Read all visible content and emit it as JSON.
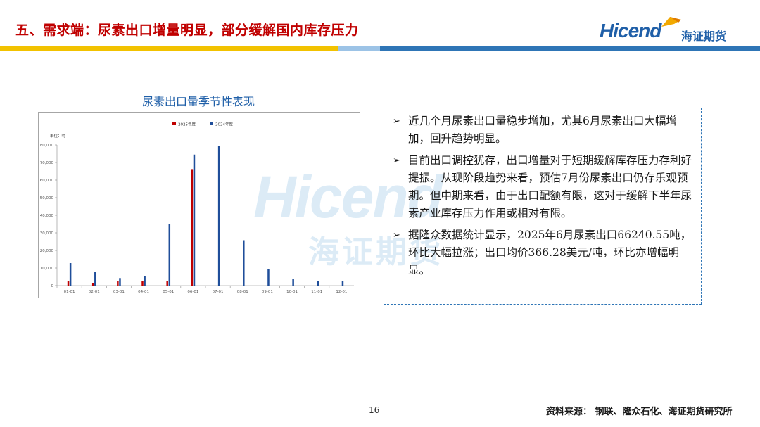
{
  "header": {
    "title": "五、需求端：尿素出口增量明显，部分缓解国内库存压力",
    "logo_en": "Hicend",
    "logo_cn": "海证期货",
    "stripe_colors": [
      "#f2c200",
      "#2e75b6"
    ]
  },
  "watermark": {
    "en": "Hicend",
    "cn": "海证期货"
  },
  "chart": {
    "heading": "尿素出口量季节性表现"
  },
  "chart_data": {
    "type": "bar",
    "title": "尿素出口量季节性表现",
    "unit_label": "单位：吨",
    "categories": [
      "01-01",
      "02-01",
      "03-01",
      "04-01",
      "05-01",
      "06-01",
      "07-01",
      "08-01",
      "09-01",
      "10-01",
      "11-01",
      "12-01"
    ],
    "series": [
      {
        "name": "2025年度",
        "color": "#c00000",
        "values": [
          2800,
          1500,
          2500,
          2500,
          2500,
          66240.55,
          null,
          null,
          null,
          null,
          null,
          null
        ]
      },
      {
        "name": "2024年度",
        "color": "#1f4e9a",
        "values": [
          12800,
          7800,
          4300,
          5300,
          35000,
          74500,
          79500,
          25800,
          9500,
          3800,
          2400,
          2400
        ]
      }
    ],
    "yticks": [
      "0",
      "10,000",
      "20,000",
      "30,000",
      "40,000",
      "50,000",
      "60,000",
      "70,000",
      "80,000"
    ],
    "ylim": [
      0,
      80000
    ],
    "legend_position": "top-center",
    "grid": false
  },
  "bullets": [
    "近几个月尿素出口量稳步增加，尤其6月尿素出口大幅增加，回升趋势明显。",
    "目前出口调控犹存，出口增量对于短期缓解库存压力存利好提振。从现阶段趋势来看，预估7月份尿素出口仍存乐观预期。但中期来看，由于出口配额有限，这对于缓解下半年尿素产业库存压力作用或相对有限。",
    "据隆众数据统计显示，2025年6月尿素出口66240.55吨，环比大幅拉涨；出口均价366.28美元/吨，环比亦增幅明显。"
  ],
  "footer": {
    "page_number": "16",
    "source": "资料来源：  钢联、隆众石化、海证期货研究所"
  }
}
